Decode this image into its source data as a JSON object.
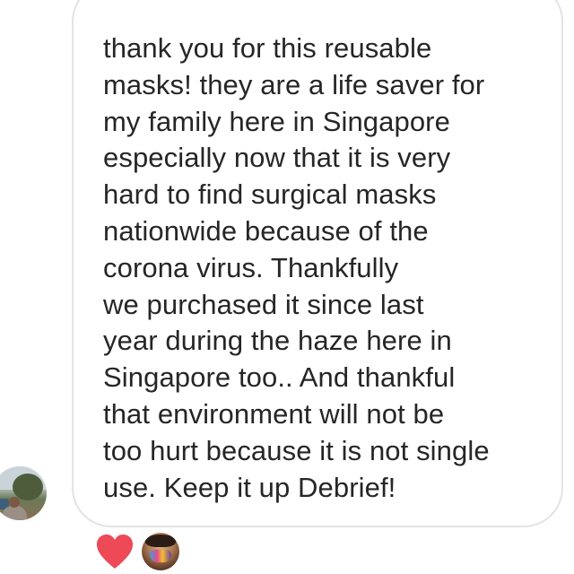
{
  "message": {
    "text": "thank you for this reusable\nmasks! they are a life saver for\nmy family here in Singapore\nespecially now that it is very\nhard to find surgical masks\nnationwide because of the\ncorona virus. Thankfully\nwe purchased it since last\nyear during the haze here in\nSingapore too.. And thankful\nthat environment will not be\ntoo hurt because it is not single\nuse. Keep it up Debrief!"
  },
  "sender": {
    "avatar_icon": "user-photo-avatar"
  },
  "reactions": [
    {
      "icon": "heart-icon",
      "color": "#ed4956"
    },
    {
      "icon": "reactor-avatar-photo"
    }
  ],
  "colors": {
    "bubble_border": "#e3e3e3",
    "text": "#262626",
    "background": "#ffffff"
  }
}
